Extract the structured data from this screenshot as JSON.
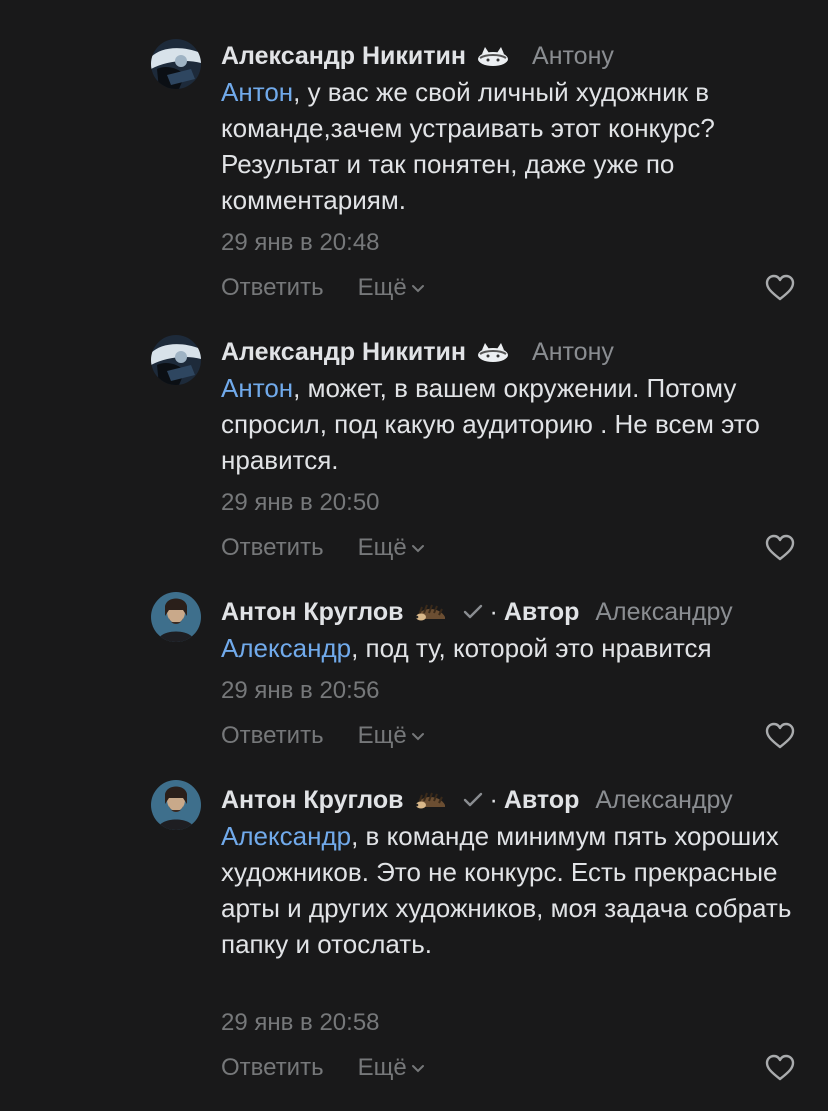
{
  "comments": [
    {
      "author": "Александр Никитин",
      "avatar": "avatar-aleksandr",
      "badge_icon": "cat-emoji-icon",
      "reply_to": "Антону",
      "mention": "Антон",
      "text": ", у вас же свой личный художник в команде,зачем устраивать этот конкурс? Результат и так понятен, даже уже по комментариям.",
      "time": "29 янв в 20:48",
      "reply_label": "Ответить",
      "more_label": "Ещё"
    },
    {
      "author": "Александр Никитин",
      "avatar": "avatar-aleksandr",
      "badge_icon": "cat-emoji-icon",
      "reply_to": "Антону",
      "mention": "Антон",
      "text": ", может, в вашем окружении. Потому спросил, под какую аудиторию . Не всем это нравится.",
      "time": "29 янв в 20:50",
      "reply_label": "Ответить",
      "more_label": "Ещё"
    },
    {
      "author": "Антон Круглов",
      "avatar": "avatar-anton",
      "badge_icon": "hedgehog-emoji-icon",
      "role": "Автор",
      "dot": "·",
      "reply_to": "Александру",
      "mention": "Александр",
      "text": ", под ту, которой это нравится",
      "time": "29 янв в 20:56",
      "reply_label": "Ответить",
      "more_label": "Ещё"
    },
    {
      "author": "Антон Круглов",
      "avatar": "avatar-anton",
      "badge_icon": "hedgehog-emoji-icon",
      "role": "Автор",
      "dot": "·",
      "reply_to": "Александру",
      "mention": "Александр",
      "text": ", в команде минимум пять хороших художников. Это не конкурс. Есть прекрасные арты и других художников, моя задача собрать папку и отослать.",
      "time": "29 янв в 20:58",
      "reply_label": "Ответить",
      "more_label": "Ещё"
    }
  ],
  "colors": {
    "background": "#19191a",
    "text": "#e1e3e6",
    "secondary": "#76787a",
    "mention": "#71aaeb"
  }
}
